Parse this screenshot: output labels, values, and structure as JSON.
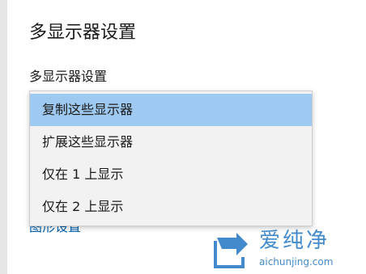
{
  "header": {
    "title": "多显示器设置"
  },
  "multi_display": {
    "label": "多显示器设置",
    "options": [
      "复制这些显示器",
      "扩展这些显示器",
      "仅在 1 上显示",
      "仅在 2 上显示"
    ],
    "selected": "复制这些显示器"
  },
  "links": {
    "graphics_settings": "图形设置"
  },
  "watermark": {
    "text": "爱纯净",
    "domain": "aichunjing.com"
  },
  "colors": {
    "selected_bg": "#9ec9f1",
    "link": "#0063b1",
    "watermark": "#2f7ec7"
  }
}
